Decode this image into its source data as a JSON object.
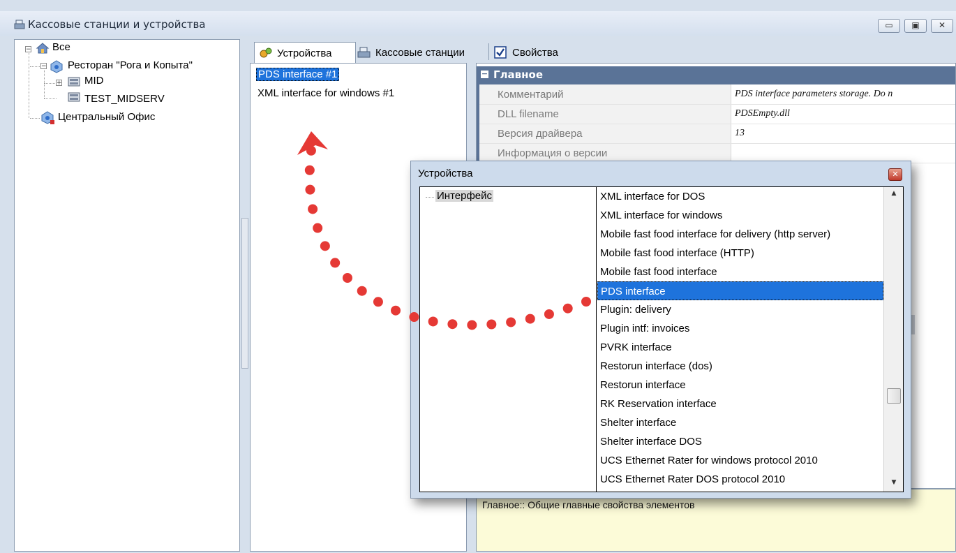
{
  "window": {
    "title": "Кассовые станции и устройства",
    "minimize": "▭",
    "restore": "▣",
    "close": "✕"
  },
  "tree": {
    "root": "Все",
    "restaurant": "Ресторан \"Рога и Копыта\"",
    "server1": "MID",
    "server2": "TEST_MIDSERV",
    "office": "Центральный Офис"
  },
  "tabs": [
    "Устройства",
    "Кассовые станции",
    "Свойства"
  ],
  "devices": [
    "PDS interface #1",
    "XML interface for windows #1"
  ],
  "properties": {
    "section": "Главное",
    "rows": [
      {
        "key": "Комментарий",
        "value": "PDS interface parameters storage. Do n"
      },
      {
        "key": "DLL filename",
        "value": "PDSEmpty.dll"
      },
      {
        "key": "Версия драйвера",
        "value": "13"
      },
      {
        "key": "Информация о версии",
        "value": ""
      }
    ],
    "description": "Главное:: Общие главные свойства элементов"
  },
  "dialog": {
    "title": "Устройства",
    "close": "✕",
    "category": "Интерфейс",
    "options": [
      "XML interface for DOS",
      "XML interface for windows",
      "Mobile fast food interface for delivery (http server)",
      "Mobile fast food interface (HTTP)",
      "Mobile fast food interface",
      "PDS interface",
      "Plugin: delivery",
      "Plugin intf: invoices",
      "PVRK interface",
      "Restorun interface (dos)",
      "Restorun interface",
      "RK Reservation interface",
      "Shelter interface",
      "Shelter interface DOS",
      "UCS Ethernet Rater for windows protocol 2010",
      "UCS Ethernet Rater DOS protocol 2010"
    ],
    "selected_index": 5,
    "scroll_up": "▲",
    "scroll_down": "▼"
  },
  "colors": {
    "selection": "#1e73dc",
    "section_header": "#5a7397",
    "annotation_arrow": "#e53935"
  }
}
